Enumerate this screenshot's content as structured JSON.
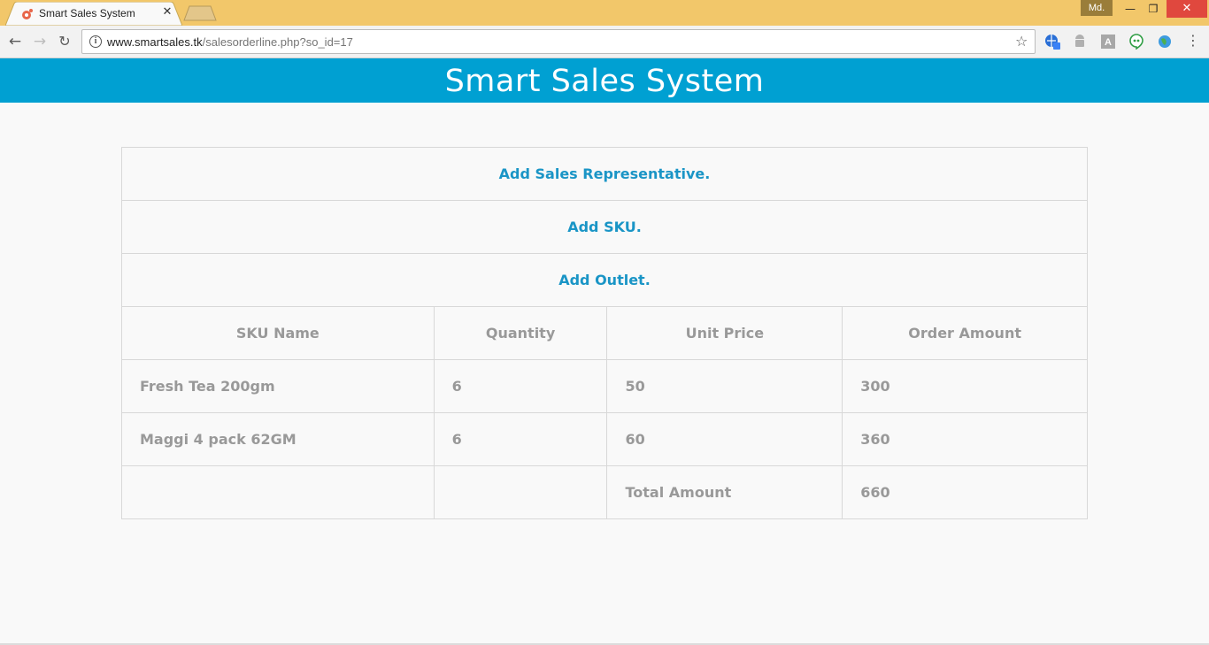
{
  "browser": {
    "tab_title": "Smart Sales System",
    "tab_close": "✕",
    "profile": "Md.",
    "window_controls": {
      "minimize": "—",
      "maximize": "❐",
      "close": "✕"
    },
    "url_host": "www.smartsales.tk",
    "url_path": "/salesorderline.php?so_id=17",
    "extension_icons": [
      "globe-translate-icon",
      "android-icon",
      "font-a-icon",
      "hangouts-icon",
      "earth-icon"
    ]
  },
  "page": {
    "header_title": "Smart Sales System",
    "links": {
      "add_sales_rep": "Add Sales Representative.",
      "add_sku": "Add SKU.",
      "add_outlet": "Add Outlet."
    },
    "table": {
      "headers": [
        "SKU Name",
        "Quantity",
        "Unit Price",
        "Order Amount"
      ],
      "rows": [
        [
          "Fresh Tea 200gm",
          "6",
          "50",
          "300"
        ],
        [
          "Maggi 4 pack 62GM",
          "6",
          "60",
          "360"
        ]
      ],
      "total_label": "Total Amount",
      "total_value": "660"
    }
  },
  "colors": {
    "header_bg": "#00a0d2",
    "link": "#1a95c6",
    "chrome_frame": "#f2c76a",
    "close_button": "#e0483e"
  }
}
